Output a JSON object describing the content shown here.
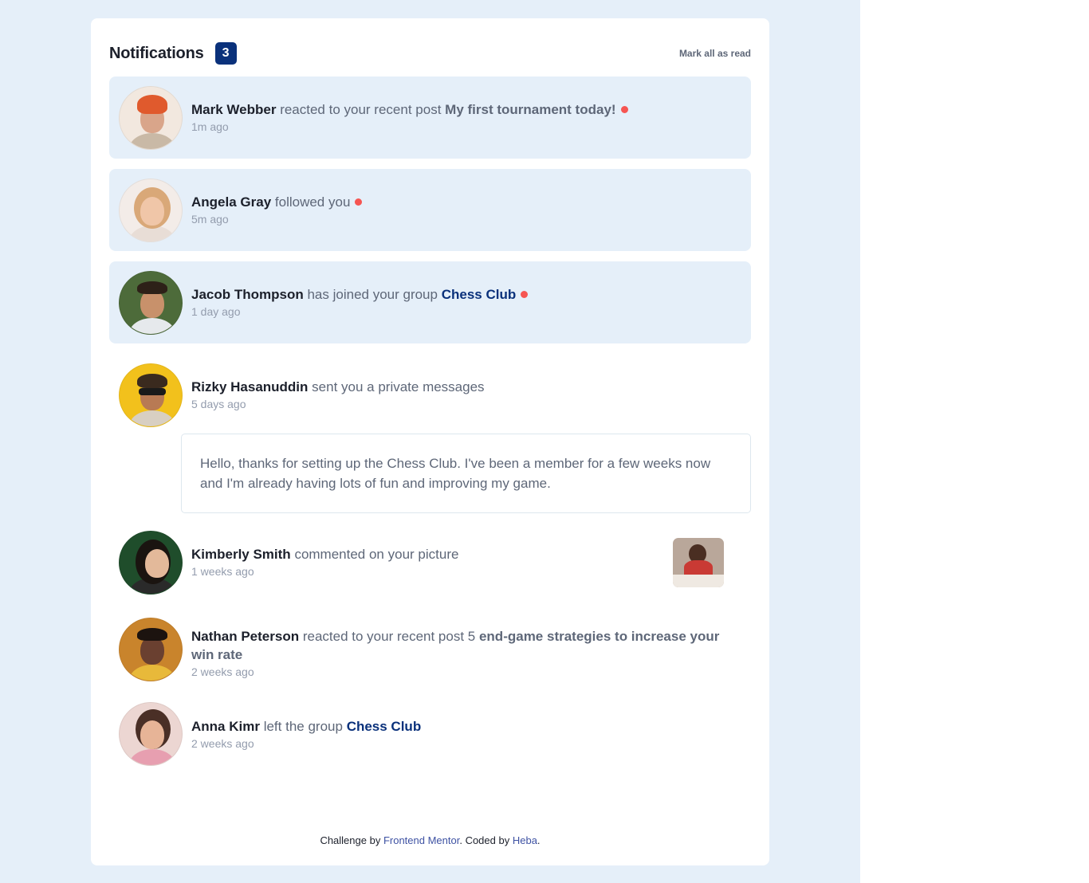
{
  "header": {
    "title": "Notifications",
    "unread_count": "3",
    "mark_all_label": "Mark all as read"
  },
  "notifications": [
    {
      "name": "Mark Webber",
      "action": "reacted to your recent post",
      "target": "My first tournament today!",
      "target_kind": "post",
      "time": "1m ago",
      "unread": true
    },
    {
      "name": "Angela Gray",
      "action": "followed you",
      "time": "5m ago",
      "unread": true
    },
    {
      "name": "Jacob Thompson",
      "action": "has joined your group",
      "target": "Chess Club",
      "target_kind": "group",
      "time": "1 day ago",
      "unread": true
    },
    {
      "name": "Rizky Hasanuddin",
      "action": "sent you a private messages",
      "time": "5 days ago",
      "unread": false,
      "message": "Hello, thanks for setting up the Chess Club. I've been a member for a few weeks now and I'm already having lots of fun and improving my game."
    },
    {
      "name": "Kimberly Smith",
      "action": "commented on your picture",
      "time": "1 weeks ago",
      "unread": false
    },
    {
      "name": "Nathan Peterson",
      "action": "reacted to your recent post 5",
      "target": "end-game strategies to increase your win rate",
      "target_kind": "post",
      "time": "2 weeks ago",
      "unread": false
    },
    {
      "name": "Anna Kimr",
      "action": "left the group",
      "target": "Chess Club",
      "target_kind": "group",
      "time": "2 weeks ago",
      "unread": false
    }
  ],
  "footer": {
    "prefix": "Challenge by",
    "link1": "Frontend Mentor",
    "middle": ". Coded by",
    "link2": "Heba",
    "suffix": "."
  },
  "colors": {
    "unread_bg": "#e5eff9",
    "badge_bg": "#0a317b",
    "dot_red": "#f65552",
    "group_link": "#0a317b",
    "footer_link": "#3e52a3"
  }
}
